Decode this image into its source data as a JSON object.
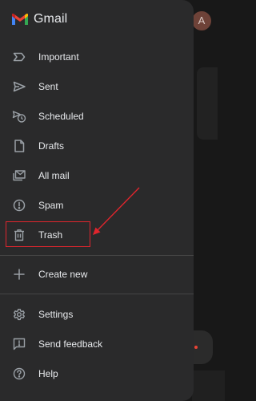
{
  "app": {
    "brand_name": "Gmail"
  },
  "account": {
    "avatar_initial": "A",
    "avatar_color": "#6e4238"
  },
  "drawer": {
    "items": [
      {
        "label": "Important",
        "icon": "important-icon"
      },
      {
        "label": "Sent",
        "icon": "send-icon"
      },
      {
        "label": "Scheduled",
        "icon": "scheduled-icon"
      },
      {
        "label": "Drafts",
        "icon": "draft-icon"
      },
      {
        "label": "All mail",
        "icon": "all-mail-icon"
      },
      {
        "label": "Spam",
        "icon": "spam-icon"
      },
      {
        "label": "Trash",
        "icon": "trash-icon"
      }
    ],
    "create_new": {
      "label": "Create new",
      "icon": "plus-icon"
    },
    "footer_items": [
      {
        "label": "Settings",
        "icon": "gear-icon"
      },
      {
        "label": "Send feedback",
        "icon": "feedback-icon"
      },
      {
        "label": "Help",
        "icon": "help-icon"
      }
    ]
  },
  "annotation": {
    "highlighted_item": "Trash",
    "color": "#e0252d"
  },
  "colors": {
    "drawer_background": "#2a2a2b",
    "text": "#e8eaed",
    "icon": "#9aa0a6",
    "scrim": "#181818"
  }
}
